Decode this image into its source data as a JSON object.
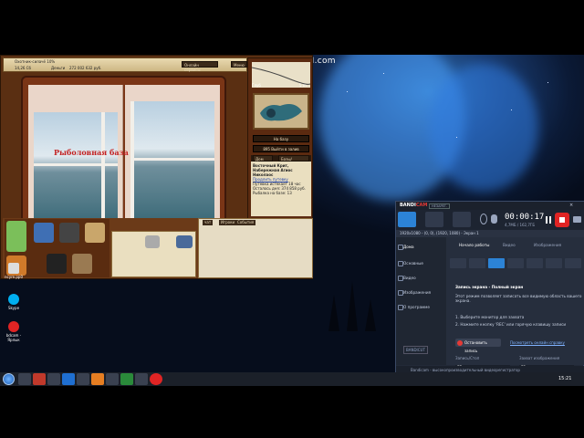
{
  "recorder_watermark": "www.BANDICAM.com",
  "game": {
    "status_line": "Охотник-силачё 10%",
    "money_label": "Деньги",
    "money_value": "272 002 632 руб.",
    "weight_value": "14,26 Сб",
    "online_btn": "Онлайн сервисы",
    "menu_btn": "Меню",
    "book_title": "Рыболовная база",
    "right_panel": {
      "distance_label": "Дальн",
      "distance_value": "5 m",
      "depth_label": "Глуб",
      "to_base": "На базу",
      "to_base_num": "895",
      "go_to_sea": "Выйти в залив",
      "tab_home": "Дом",
      "tab_locations": "Базы/лоткапи",
      "location_name": "Восточный Крит, Набережная Агиос Николаос",
      "buy_voucher": "Продлить путевку",
      "voucher_info": "Путевка истекает 18 час",
      "info_line2": "Осталось дня: 374 858 руб.",
      "info_line3": "Рыбалка на базе: 13",
      "buy_btn": "Запросы..."
    },
    "chat_tabs": [
      "чат",
      "Игроки",
      "События"
    ],
    "rod_label": "Удилище"
  },
  "desktop_icons": [
    {
      "label": "ncyre.pp0"
    },
    {
      "label": "Skype"
    },
    {
      "label": "bdcam - Ярлык"
    }
  ],
  "bandicam": {
    "logo_main": "BANDI",
    "logo_accent": "CAM",
    "unregistered": "НЕЗАРЕГ.",
    "timer": "00:00:17",
    "size": "4,7МБ / 162,7ГБ",
    "path": "1920x1080 - (0, 0), (1920, 1080) - Экран 1",
    "sidebar": [
      "Дома",
      "Основные",
      "Видео",
      "Изображения",
      "О программе"
    ],
    "main_tabs": [
      "Начало работы",
      "Видео",
      "Изображения"
    ],
    "section_title": "Запись экрана - Полный экран",
    "section_desc": "Этот режим позволяет записать все видимую область вашего экрана.",
    "step1": "1. Выберите монитор для захвата",
    "step2": "2. Нажмите кнопку 'REC' или горячую клавишу записи",
    "stop_btn": "Остановить запись",
    "help_link": "Посмотреть онлайн справку",
    "hotkey_rec_label": "Запись/Стоп",
    "hotkey_rec_value": "F2",
    "hotkey_img_label": "Захват изображения",
    "hotkey_img_value": "F1",
    "bandicut": "BANDICUT",
    "footer": "Bandicam - высокопроизводительный видеорегистратор",
    "colors": {
      "accent": "#2c83d6",
      "rec": "#e02424"
    }
  },
  "taskbar": {
    "clock": "15:21"
  }
}
